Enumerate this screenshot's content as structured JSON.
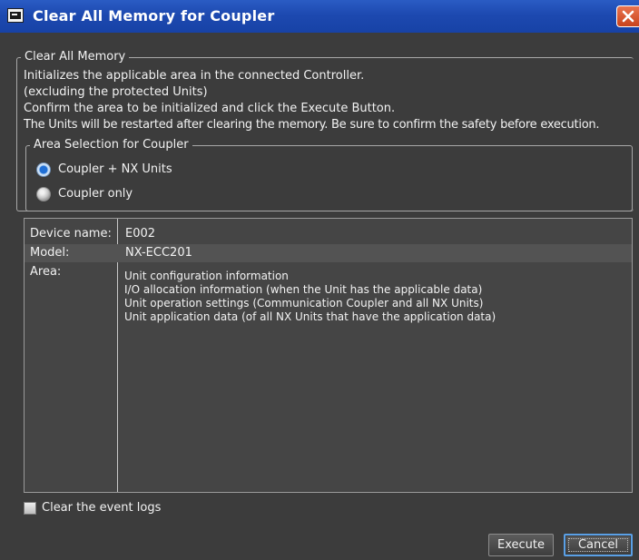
{
  "window": {
    "title": "Clear All Memory for Coupler"
  },
  "clear_all_memory": {
    "legend": "Clear All Memory",
    "lines": [
      "Initializes the applicable area in the connected Controller.",
      "(excluding the protected Units)",
      "Confirm the area to be initialized and click the Execute Button.",
      "The Units will be restarted after clearing the memory. Be sure to confirm the safety before execution."
    ]
  },
  "area_selection": {
    "legend": "Area Selection for Coupler",
    "options": [
      {
        "label": "Coupler + NX Units",
        "selected": true
      },
      {
        "label": "Coupler only",
        "selected": false
      }
    ]
  },
  "info": {
    "device_name_key": "Device name:",
    "device_name_value": "E002",
    "model_key": "Model:",
    "model_value": "NX-ECC201",
    "area_key": "Area:",
    "area_lines": [
      "Unit configuration information",
      "I/O allocation information (when the Unit has the applicable data)",
      "Unit operation settings (Communication Coupler and all NX Units)",
      "Unit application data (of all NX Units that have the application data)"
    ]
  },
  "clear_event_logs": {
    "label": "Clear the event logs",
    "checked": false
  },
  "buttons": {
    "execute": "Execute",
    "cancel": "Cancel"
  },
  "icons": {
    "app": "app-window-icon",
    "close": "close-icon"
  },
  "colors": {
    "title_bar": "#1d49b0",
    "dialog_bg": "#3c3c3c",
    "close_button": "#d9552c",
    "radio_selected": "#1f6fd6"
  }
}
